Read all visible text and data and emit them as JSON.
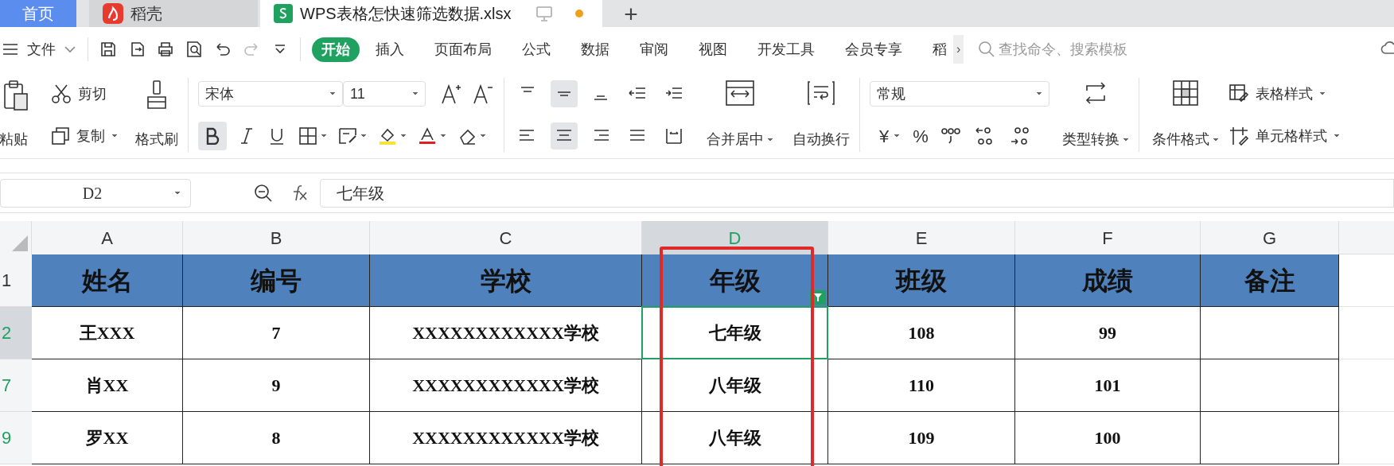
{
  "tabs": [
    {
      "label": "首页",
      "kind": "home",
      "selected": false
    },
    {
      "label": "稻壳",
      "kind": "docer",
      "selected": false
    },
    {
      "label": "WPS表格怎快速筛选数据.xlsx",
      "kind": "sheet",
      "selected": true,
      "unsaved": true
    }
  ],
  "new_tab": "+",
  "menu": {
    "file": "文件",
    "tabs": [
      {
        "label": "开始",
        "selected": true
      },
      {
        "label": "插入",
        "selected": false
      },
      {
        "label": "页面布局",
        "selected": false
      },
      {
        "label": "公式",
        "selected": false
      },
      {
        "label": "数据",
        "selected": false
      },
      {
        "label": "审阅",
        "selected": false
      },
      {
        "label": "视图",
        "selected": false
      },
      {
        "label": "开发工具",
        "selected": false
      },
      {
        "label": "会员专享",
        "selected": false
      },
      {
        "label": "稻",
        "selected": false
      }
    ],
    "more": "›",
    "search_placeholder": "查找命令、搜索模板"
  },
  "ribbon": {
    "paste": "粘贴",
    "cut": "剪切",
    "copy": "复制",
    "format_painter": "格式刷",
    "font": "宋体",
    "font_size": "11",
    "bold": true,
    "valign_middle": true,
    "align_center": true,
    "merge": "合并居中",
    "wrap": "自动换行",
    "number_format": "常规",
    "currency": "¥",
    "percent": "%",
    "convert": "类型转换",
    "conditional": "条件格式",
    "table_style": "表格样式",
    "cell_style": "单元格样式"
  },
  "formula_bar": {
    "name_box": "D2",
    "formula": "七年级"
  },
  "sheet": {
    "columns": [
      {
        "label": "A",
        "selected": false,
        "filter": false,
        "highlighted": false
      },
      {
        "label": "B",
        "selected": false,
        "filter": false,
        "highlighted": false
      },
      {
        "label": "C",
        "selected": false,
        "filter": false,
        "highlighted": false
      },
      {
        "label": "D",
        "selected": true,
        "filter": true,
        "highlighted": true
      },
      {
        "label": "E",
        "selected": false,
        "filter": false,
        "highlighted": false
      },
      {
        "label": "F",
        "selected": false,
        "filter": false,
        "highlighted": false
      },
      {
        "label": "G",
        "selected": false,
        "filter": false,
        "highlighted": false
      }
    ],
    "rows": [
      {
        "number": "1",
        "kind": "header",
        "filtered": false,
        "selected": false,
        "cells": [
          "姓名",
          "编号",
          "学校",
          "年级",
          "班级",
          "成绩",
          "备注"
        ]
      },
      {
        "number": "2",
        "kind": "data",
        "filtered": true,
        "selected": true,
        "cells": [
          "王XXX",
          "7",
          "XXXXXXXXXXXX学校",
          "七年级",
          "108",
          "99"
        ]
      },
      {
        "number": "7",
        "kind": "data",
        "filtered": true,
        "selected": false,
        "cells": [
          "肖XX",
          "9",
          "XXXXXXXXXXXX学校",
          "八年级",
          "110",
          "101"
        ]
      },
      {
        "number": "9",
        "kind": "data",
        "filtered": true,
        "selected": false,
        "cells": [
          "罗XX",
          "8",
          "XXXXXXXXXXXX学校",
          "八年级",
          "109",
          "100"
        ]
      }
    ]
  }
}
